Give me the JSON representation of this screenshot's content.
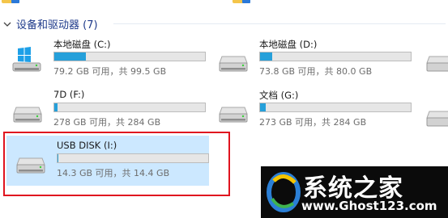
{
  "section": {
    "title": "设备和驱动器 (7)"
  },
  "drives": [
    {
      "name": "本地磁盘 (C:)",
      "usage": 0.21,
      "info": "79.2 GB 可用，共 99.5 GB",
      "icon": "windows-drive-icon",
      "selected": false
    },
    {
      "name": "本地磁盘 (D:)",
      "usage": 0.08,
      "info": "73.8 GB 可用，共 80.0 GB",
      "icon": "hard-drive-icon",
      "selected": false
    },
    {
      "name": "7D (F:)",
      "usage": 0.02,
      "info": "278 GB 可用，共 284 GB",
      "icon": "hard-drive-icon",
      "selected": false
    },
    {
      "name": "文档 (G:)",
      "usage": 0.04,
      "info": "273 GB 可用，共 284 GB",
      "icon": "hard-drive-icon",
      "selected": false
    },
    {
      "name": "USB DISK (I:)",
      "usage": 0.007,
      "info": "14.3 GB 可用，共 14.4 GB",
      "icon": "usb-drive-icon",
      "selected": true
    }
  ],
  "watermark": {
    "title": "系统之家",
    "url": "www.Ghost123.com"
  },
  "colors": {
    "accent": "#26a0da",
    "selection": "#cce8ff",
    "highlight_border": "#e0141f",
    "header_text": "#1e3a8a"
  }
}
